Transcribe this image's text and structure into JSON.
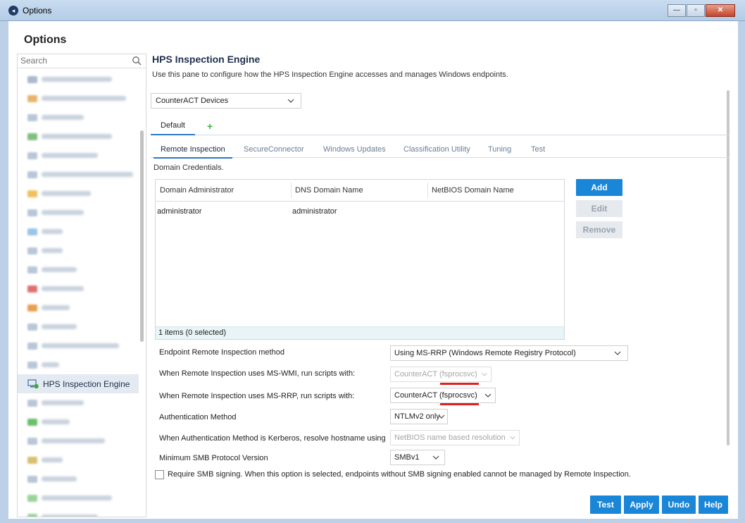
{
  "window": {
    "title": "Options"
  },
  "options_title": "Options",
  "search": {
    "placeholder": "Search"
  },
  "sidebar": {
    "selected_label": "HPS Inspection Engine"
  },
  "main": {
    "title": "HPS Inspection Engine",
    "description": "Use this pane to configure how the HPS Inspection Engine accesses and manages Windows endpoints.",
    "device_select": "CounterACT Devices",
    "profile_tab": "Default",
    "add_tab": "+",
    "tabs": [
      "Remote Inspection",
      "SecureConnector",
      "Windows Updates",
      "Classification Utility",
      "Tuning",
      "Test"
    ],
    "active_tab": "Remote Inspection",
    "section_label": "Domain Credentials."
  },
  "table": {
    "columns": [
      "Domain Administrator",
      "DNS Domain Name",
      "NetBIOS Domain Name"
    ],
    "rows": [
      [
        "administrator",
        "administrator",
        ""
      ]
    ],
    "footer": "1 items (0 selected)"
  },
  "buttons": {
    "add": "Add",
    "edit": "Edit",
    "remove": "Remove"
  },
  "settings": {
    "method_label": "Endpoint Remote Inspection method",
    "method_value": "Using MS-RRP (Windows Remote Registry Protocol)",
    "wmi_label": "When Remote Inspection uses MS-WMI, run scripts with:",
    "wmi_value": "CounterACT (fsprocsvc)",
    "rrp_label": "When Remote Inspection uses MS-RRP, run scripts with:",
    "rrp_value": "CounterACT (fsprocsvc)",
    "auth_label": "Authentication Method",
    "auth_value": "NTLMv2 only",
    "kerberos_label": "When Authentication Method is Kerberos, resolve hostname using",
    "kerberos_value": "NetBIOS name based resolution",
    "smb_label": "Minimum SMB Protocol Version",
    "smb_value": "SMBv1",
    "smb_signing_label": "Require SMB signing. When this option is selected, endpoints without SMB signing enabled cannot be managed by Remote Inspection.",
    "smb_signing_checked": false
  },
  "footer_buttons": {
    "test": "Test",
    "apply": "Apply",
    "undo": "Undo",
    "help": "Help"
  },
  "colors": {
    "accent": "#1a86d8",
    "highlight": "#e02020"
  }
}
